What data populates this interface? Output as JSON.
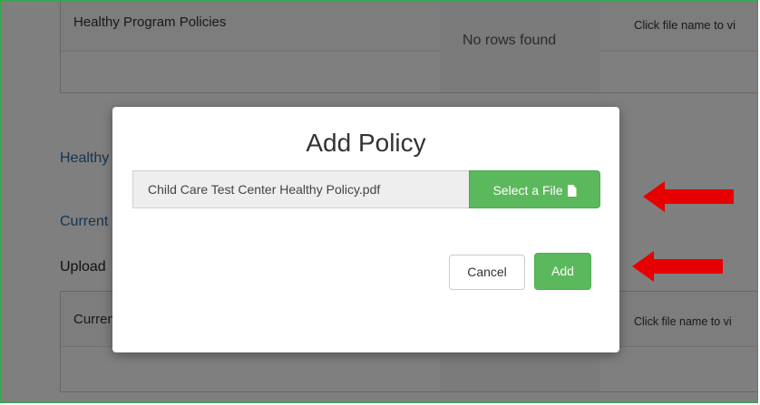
{
  "background": {
    "top_panel": {
      "column_title": "Healthy Program Policies",
      "right_text": "Click file name to vi",
      "empty_text": "No rows found"
    },
    "section_link": "Healthy",
    "current_link": "Current",
    "upload_label": "Upload",
    "bottom_panel": {
      "column_title": "Current",
      "right_text": "Click file name to vi"
    }
  },
  "modal": {
    "title": "Add Policy",
    "file_name": "Child Care Test Center Healthy Policy.pdf",
    "select_label": "Select a File",
    "select_icon": "file-icon",
    "cancel_label": "Cancel",
    "add_label": "Add"
  },
  "annotations": {
    "arrow_color": "#e60000",
    "arrows": [
      "arrow-to-select-file",
      "arrow-to-add"
    ]
  },
  "colors": {
    "accent_green": "#5cb85c",
    "frame_green": "#2fa84a",
    "link_blue": "#2c6aa0"
  }
}
